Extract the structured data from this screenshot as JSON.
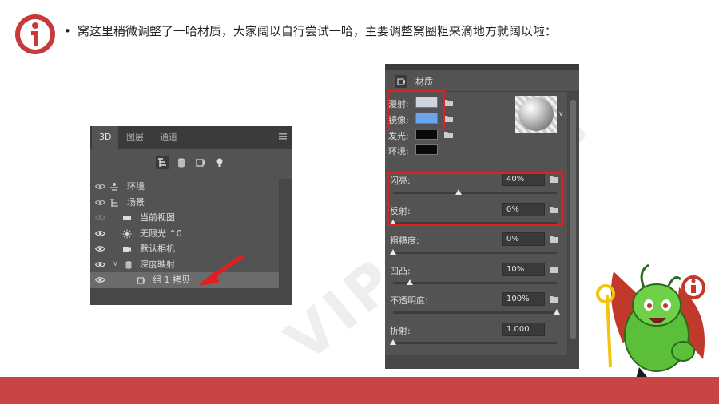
{
  "slide": {
    "bullet_text": "窝这里稍微调整了一哈材质，大家阔以自行尝试一哈，主要调整窝圈粗来滴地方就阔以啦：",
    "watermark": "VIP会员专用",
    "accent_color": "#c94545"
  },
  "panel3d": {
    "tabs": [
      {
        "label": "3D"
      },
      {
        "label": "图层"
      },
      {
        "label": "通道"
      }
    ],
    "toolbar_icons": [
      "scene-filter-icon",
      "mesh-filter-icon",
      "material-filter-icon",
      "light-filter-icon"
    ],
    "rows": [
      {
        "label": "环境",
        "icon": "environment-icon"
      },
      {
        "label": "场景",
        "icon": "scene-icon"
      },
      {
        "label": "当前视图",
        "icon": "camera-icon"
      },
      {
        "label": "无限光 ^0",
        "icon": "sun-icon"
      },
      {
        "label": "默认相机",
        "icon": "camera-icon"
      },
      {
        "label": "深度映射",
        "icon": "mesh-icon"
      },
      {
        "label": "组 1 拷贝",
        "icon": "material-icon"
      }
    ]
  },
  "materials": {
    "title": "材质",
    "colors": [
      {
        "label": "漫射:",
        "color": "#cfd5dd"
      },
      {
        "label": "镜像:",
        "color": "#6aa6f0"
      },
      {
        "label": "发光:",
        "color": "#0a0a0a"
      },
      {
        "label": "环境:",
        "color": "#0a0a0a"
      }
    ],
    "sliders": [
      {
        "label": "闪亮:",
        "value": "40%",
        "pct": 0.4
      },
      {
        "label": "反射:",
        "value": "0%",
        "pct": 0.0
      },
      {
        "label": "粗糙度:",
        "value": "0%",
        "pct": 0.0
      },
      {
        "label": "凹凸:",
        "value": "10%",
        "pct": 0.1
      },
      {
        "label": "不透明度:",
        "value": "100%",
        "pct": 1.0
      },
      {
        "label": "折射:",
        "value": "1.000",
        "pct": 0.0
      }
    ]
  }
}
